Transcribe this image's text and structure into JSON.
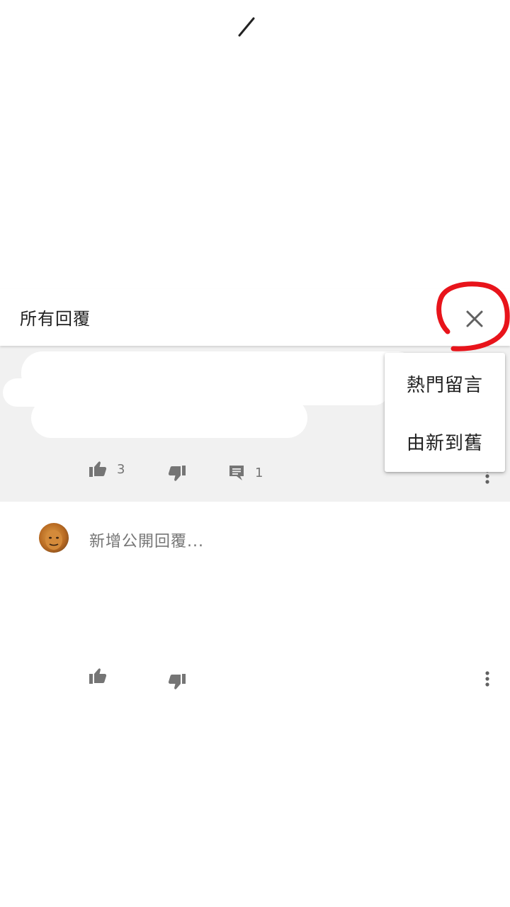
{
  "header": {
    "title": "所有回覆",
    "close_icon": "close-icon"
  },
  "comment": {
    "likes": "3",
    "replies": "1"
  },
  "sort_menu": {
    "items": [
      "熱門留言",
      "由新到舊"
    ]
  },
  "reply_box": {
    "placeholder": "新增公開回覆..."
  },
  "colors": {
    "annotation": "#e8141b",
    "icon": "#757575",
    "comment_background": "#f1f1f1"
  }
}
